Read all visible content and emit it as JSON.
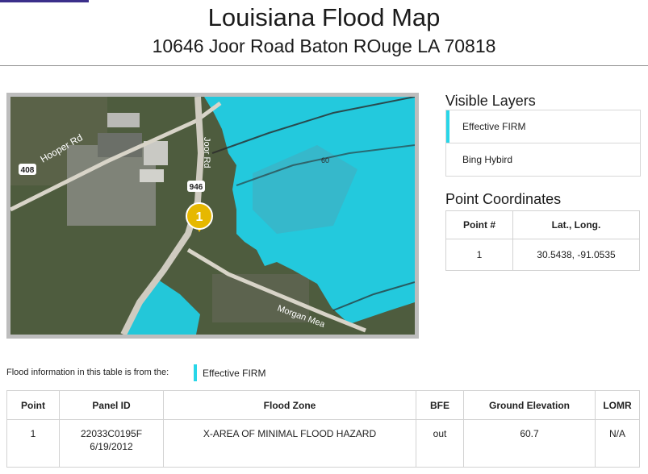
{
  "header": {
    "title": "Louisiana Flood Map",
    "address": "10646 Joor Road Baton ROuge LA 70818"
  },
  "map": {
    "labels": {
      "hooper_rd": "Hooper Rd",
      "joor_rd": "Joor Rd",
      "shield_408": "408",
      "shield_946": "946",
      "morgan": "Morgan Mea",
      "contour": "60"
    },
    "marker_label": "1",
    "colors": {
      "flood_zone": "#1fd3ea",
      "marker": "#e6b800",
      "vegetation": "#4e5c3e"
    }
  },
  "layers": {
    "heading": "Visible Layers",
    "items": [
      {
        "label": "Effective FIRM",
        "active": true
      },
      {
        "label": "Bing Hybird",
        "active": false
      }
    ]
  },
  "coordinates": {
    "heading": "Point Coordinates",
    "columns": [
      "Point #",
      "Lat., Long."
    ],
    "rows": [
      {
        "point": "1",
        "latlong": "30.5438, -91.0535"
      }
    ]
  },
  "flood_info": {
    "note": "Flood information in this table is from the:",
    "source": "Effective FIRM",
    "columns": [
      "Point",
      "Panel ID",
      "Flood Zone",
      "BFE",
      "Ground Elevation",
      "LOMR"
    ],
    "rows": [
      {
        "point": "1",
        "panel_id": "22033C0195F",
        "panel_date": "6/19/2012",
        "flood_zone": "X-AREA OF MINIMAL FLOOD HAZARD",
        "bfe": "out",
        "ground_elevation": "60.7",
        "lomr": "N/A"
      }
    ]
  }
}
